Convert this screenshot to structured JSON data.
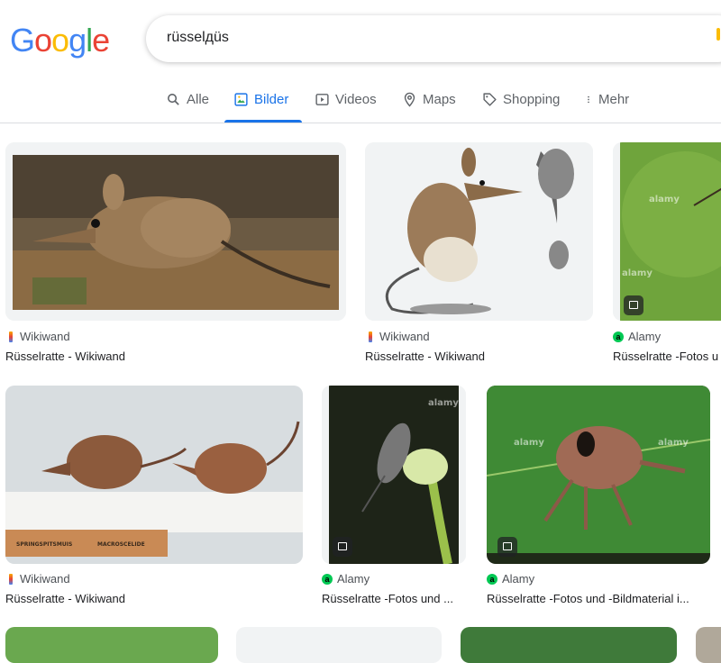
{
  "logo": {
    "letters": [
      "G",
      "o",
      "o",
      "g",
      "l",
      "e"
    ]
  },
  "search": {
    "value": "rüsselдüs"
  },
  "tabs": [
    {
      "label": "Alle"
    },
    {
      "label": "Bilder"
    },
    {
      "label": "Videos"
    },
    {
      "label": "Maps"
    },
    {
      "label": "Shopping"
    },
    {
      "label": "Mehr"
    }
  ],
  "results": [
    {
      "source": "Wikiwand",
      "caption": "Rüsselratte - Wikiwand"
    },
    {
      "source": "Wikiwand",
      "caption": "Rüsselratte - Wikiwand"
    },
    {
      "source": "Alamy",
      "caption": "Rüsselratte -Fotos u"
    },
    {
      "source": "Wikiwand",
      "caption": "Rüsselratte - Wikiwand"
    },
    {
      "source": "Alamy",
      "caption": "Rüsselratte -Fotos und ..."
    },
    {
      "source": "Alamy",
      "caption": "Rüsselratte -Fotos und -Bildmaterial i..."
    }
  ],
  "watermarks": {
    "alamy": "alamy",
    "plaque_left": "SPRINGSPITSMUIS",
    "plaque_right": "MACROSCELIDE"
  },
  "colors": {
    "accent": "#1a73e8",
    "google_blue": "#4285f4",
    "google_red": "#ea4335",
    "google_yellow": "#fbbc05",
    "google_green": "#34a853"
  }
}
